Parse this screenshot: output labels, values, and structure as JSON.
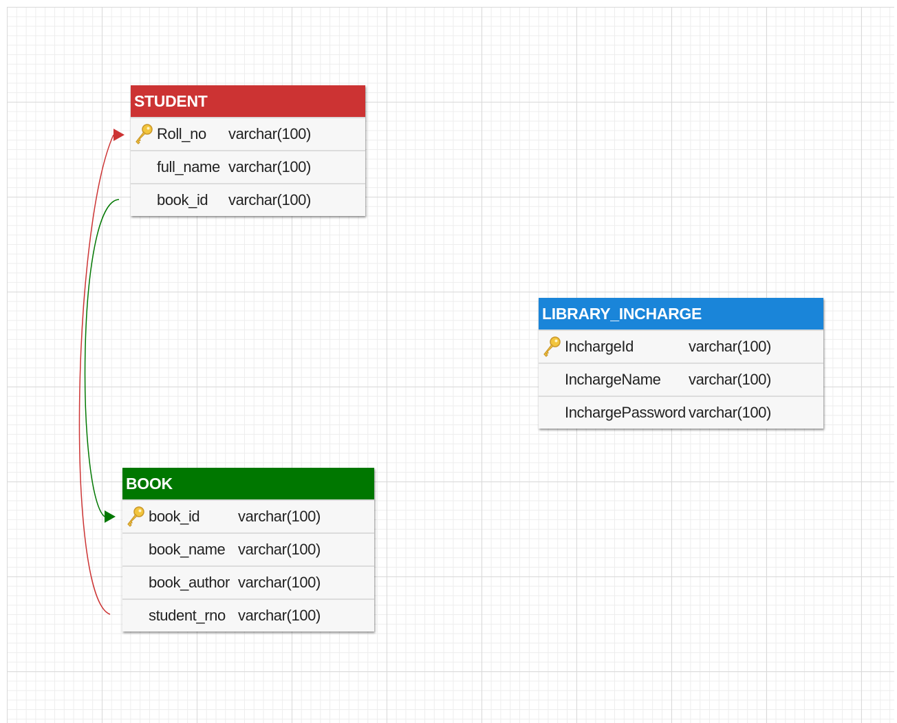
{
  "tables": [
    {
      "id": "student",
      "name": "STUDENT",
      "header_color": "#cc3333",
      "fields": [
        {
          "name": "Roll_no",
          "type": "varchar(100)",
          "primary_key": true
        },
        {
          "name": "full_name",
          "type": "varchar(100)",
          "primary_key": false
        },
        {
          "name": "book_id",
          "type": "varchar(100)",
          "primary_key": false
        }
      ]
    },
    {
      "id": "book",
      "name": "BOOK",
      "header_color": "#007700",
      "fields": [
        {
          "name": "book_id",
          "type": "varchar(100)",
          "primary_key": true
        },
        {
          "name": "book_name",
          "type": "varchar(100)",
          "primary_key": false
        },
        {
          "name": "book_author",
          "type": "varchar(100)",
          "primary_key": false
        },
        {
          "name": "student_rno",
          "type": "varchar(100)",
          "primary_key": false
        }
      ]
    },
    {
      "id": "library-incharge",
      "name": "LIBRARY_INCHARGE",
      "header_color": "#1a85d9",
      "fields": [
        {
          "name": "InchargeId",
          "type": "varchar(100)",
          "primary_key": true
        },
        {
          "name": "InchargeName",
          "type": "varchar(100)",
          "primary_key": false
        },
        {
          "name": "InchargePassword",
          "type": "varchar(100)",
          "primary_key": false
        }
      ]
    }
  ],
  "relationships": [
    {
      "from_table": "BOOK",
      "from_field": "student_rno",
      "to_table": "STUDENT",
      "to_field": "Roll_no",
      "color": "#cc3333"
    },
    {
      "from_table": "STUDENT",
      "from_field": "book_id",
      "to_table": "BOOK",
      "to_field": "book_id",
      "color": "#007700"
    }
  ],
  "icons": {
    "primary_key": "key-icon"
  }
}
